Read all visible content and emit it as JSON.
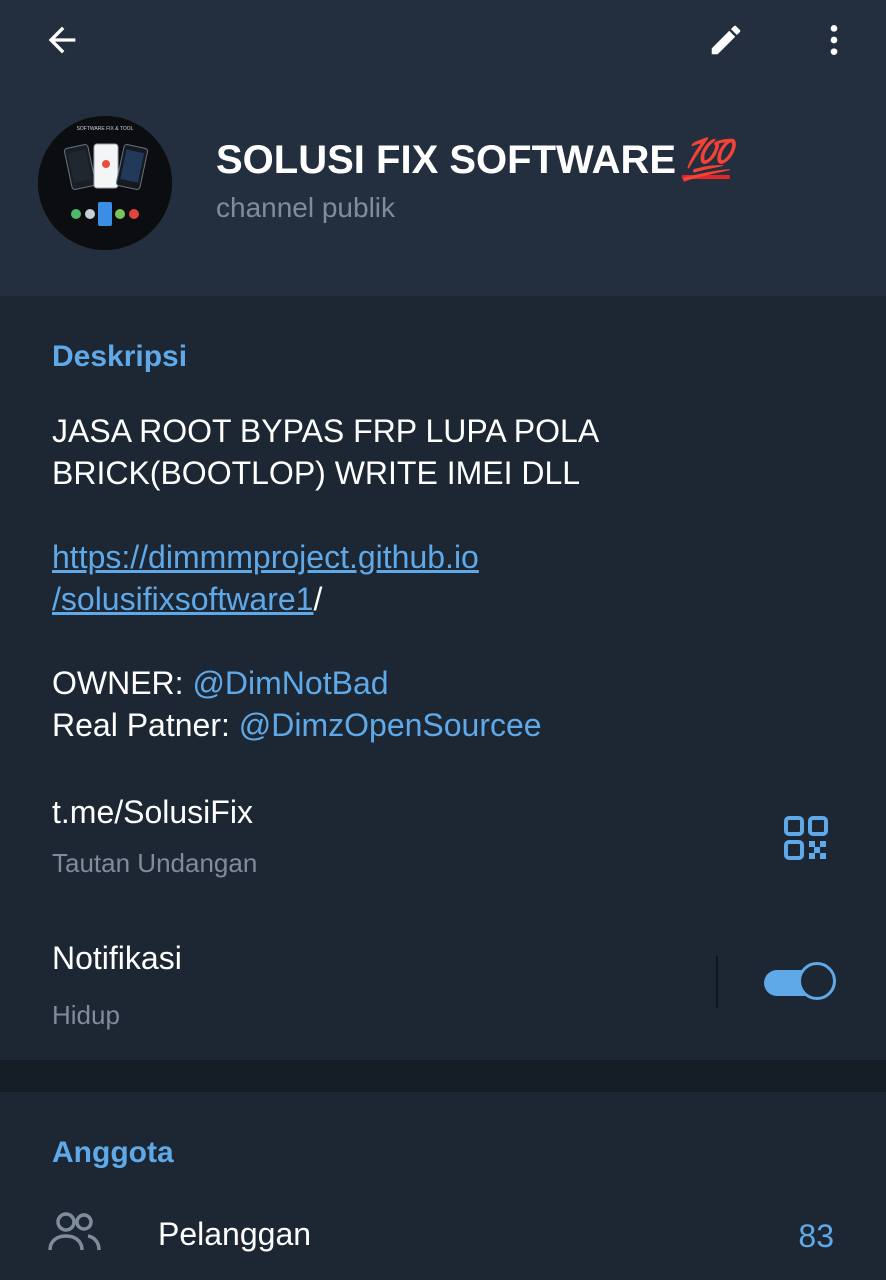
{
  "header": {
    "channel_name": "SOLUSI FIX SOFTWARE",
    "channel_emoji": "💯",
    "channel_type": "channel publik",
    "avatar_caption": "SOFTWARE FIX & TOOL"
  },
  "description": {
    "label": "Deskripsi",
    "line1": "JASA ROOT BYPAS FRP LUPA POLA",
    "line2": "BRICK(BOOTLOP) WRITE IMEI DLL",
    "link_part1": "https://dimmmproject.github.io",
    "link_part2": "/solusifixsoftware1",
    "link_suffix": "/",
    "owner_label": "OWNER: ",
    "owner_mention": "@DimNotBad",
    "partner_label": "Real Patner: ",
    "partner_mention": "@DimzOpenSourcee"
  },
  "invite": {
    "value": "t.me/SolusiFix",
    "label": "Tautan Undangan"
  },
  "notifications": {
    "label": "Notifikasi",
    "status": "Hidup",
    "enabled": true
  },
  "members": {
    "label": "Anggota",
    "subscribers_label": "Pelanggan",
    "subscribers_count": "83"
  },
  "colors": {
    "accent": "#5fa9e8",
    "header_bg": "#232f3e",
    "body_bg": "#1d2733",
    "muted_text": "#7f8d9b"
  },
  "icons": {
    "back": "arrow-left-icon",
    "edit": "pencil-icon",
    "more": "more-vertical-icon",
    "qr": "qr-code-icon",
    "people": "people-icon"
  }
}
